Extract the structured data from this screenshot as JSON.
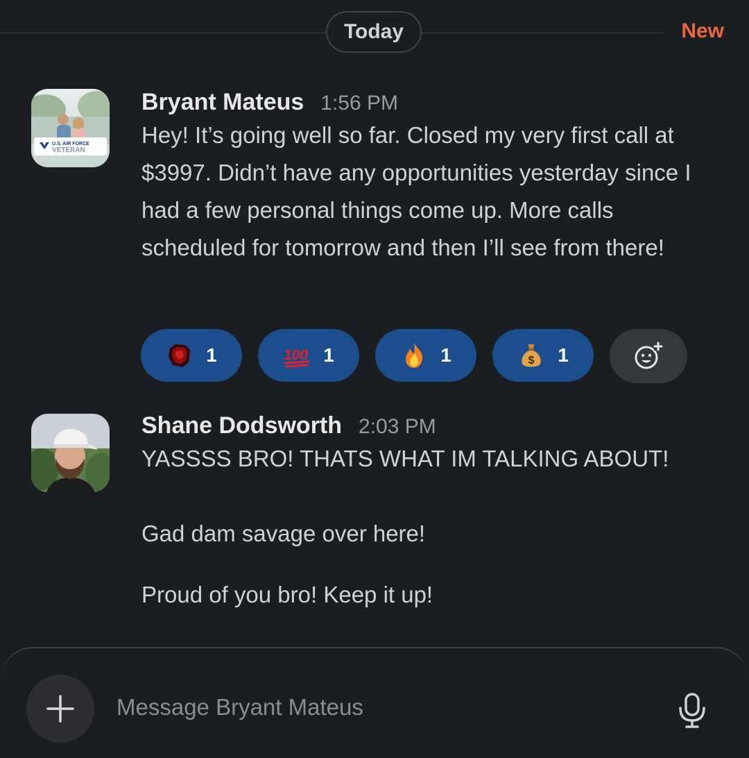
{
  "divider": {
    "date_label": "Today",
    "new_label": "New"
  },
  "colors": {
    "background": "#1a1d21",
    "new_accent": "#e8673f",
    "reaction_bg": "#1c4e8d",
    "text": "#d1d2d3"
  },
  "messages": [
    {
      "sender": "Bryant Mateus",
      "time": "1:56 PM",
      "avatar_badge_line1": "U.S. AIR FORCE",
      "avatar_badge_line2": "VETERAN",
      "text": "Hey! It’s going well so far. Closed my very first call at $3997. Didn’t have any opportunities yesterday since I had a few personal things come up. More calls scheduled for tomorrow and then I’ll see from there!",
      "reactions": [
        {
          "emoji": "red-crystal-emoji",
          "count": "1"
        },
        {
          "emoji": "hundred-points-emoji",
          "count": "1"
        },
        {
          "emoji": "fire-emoji",
          "count": "1"
        },
        {
          "emoji": "money-bag-emoji",
          "count": "1"
        }
      ],
      "add_reaction_icon": "add-reaction-icon"
    },
    {
      "sender": "Shane Dodsworth",
      "time": "2:03 PM",
      "paragraphs": [
        "YASSSS BRO! THATS WHAT IM TALKING ABOUT!",
        "Gad dam savage over here!",
        "Proud of you bro! Keep it up!"
      ]
    }
  ],
  "composer": {
    "placeholder": "Message Bryant Mateus",
    "plus_icon": "plus-icon",
    "mic_icon": "microphone-icon"
  }
}
